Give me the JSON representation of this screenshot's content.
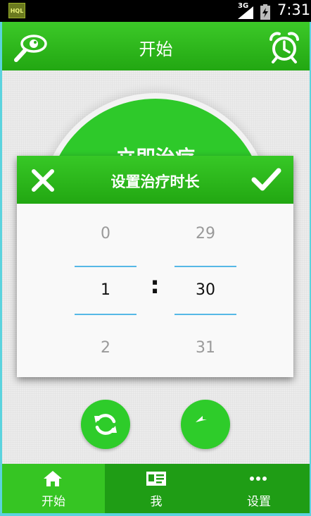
{
  "status_bar": {
    "app_icon_text": "HQL",
    "network_label": "3G",
    "time": "7:31"
  },
  "header": {
    "title": "开始",
    "left_icon": "eye-search-icon",
    "right_icon": "alarm-clock-icon"
  },
  "main": {
    "start_button_label": "立即治疗",
    "refresh_icon": "refresh-icon",
    "back_icon": "back-arrow-icon"
  },
  "dialog": {
    "title": "设置治疗时长",
    "cancel_icon": "close-icon",
    "confirm_icon": "check-icon",
    "hours": {
      "prev": "0",
      "current": "1",
      "next": "2"
    },
    "separator": ":",
    "minutes": {
      "prev": "29",
      "current": "30",
      "next": "31"
    }
  },
  "bottom_nav": {
    "items": [
      {
        "label": "开始",
        "icon": "home-icon",
        "active": true
      },
      {
        "label": "我",
        "icon": "profile-card-icon",
        "active": false
      },
      {
        "label": "设置",
        "icon": "more-icon",
        "active": false
      }
    ]
  },
  "colors": {
    "primary_green": "#2ec92a",
    "nav_active": "#36c523",
    "nav_inactive": "#1f9d15",
    "picker_divider": "#56b8e6"
  }
}
